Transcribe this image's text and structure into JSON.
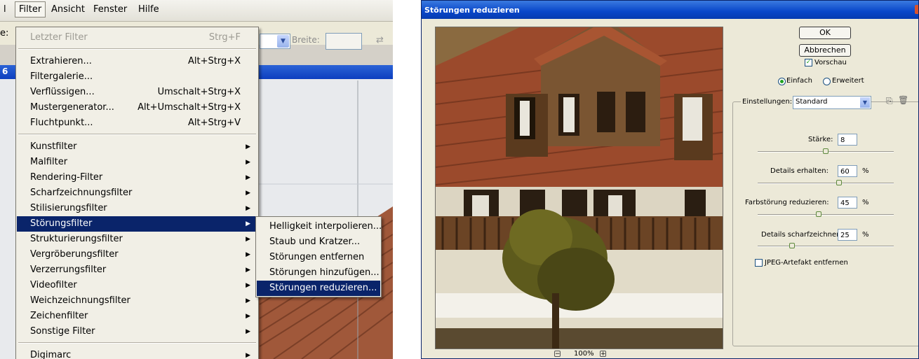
{
  "menubar": {
    "items": [
      "l",
      "Filter",
      "Ansicht",
      "Fenster",
      "Hilfe"
    ]
  },
  "optionsbar": {
    "cut_label": "e:",
    "width_label": "Breite:"
  },
  "filter_menu": {
    "items": [
      {
        "label": "Letzter Filter",
        "shortcut": "Strg+F"
      },
      {
        "label": "Extrahieren...",
        "shortcut": "Alt+Strg+X"
      },
      {
        "label": "Filtergalerie...",
        "shortcut": ""
      },
      {
        "label": "Verflüssigen...",
        "shortcut": "Umschalt+Strg+X"
      },
      {
        "label": "Mustergenerator...",
        "shortcut": "Alt+Umschalt+Strg+X"
      },
      {
        "label": "Fluchtpunkt...",
        "shortcut": "Alt+Strg+V"
      },
      {
        "label": "Kunstfilter"
      },
      {
        "label": "Malfilter"
      },
      {
        "label": "Rendering-Filter"
      },
      {
        "label": "Scharfzeichnungsfilter"
      },
      {
        "label": "Stilisierungsfilter"
      },
      {
        "label": "Störungsfilter"
      },
      {
        "label": "Strukturierungsfilter"
      },
      {
        "label": "Vergröberungsfilter"
      },
      {
        "label": "Verzerrungsfilter"
      },
      {
        "label": "Videofilter"
      },
      {
        "label": "Weichzeichnungsfilter"
      },
      {
        "label": "Zeichenfilter"
      },
      {
        "label": "Sonstige Filter"
      },
      {
        "label": "Digimarc"
      }
    ]
  },
  "noise_submenu": {
    "items": [
      "Helligkeit interpolieren...",
      "Staub und Kratzer...",
      "Störungen entfernen",
      "Störungen hinzufügen...",
      "Störungen reduzieren..."
    ]
  },
  "dialog": {
    "title": "Störungen reduzieren",
    "ok": "OK",
    "cancel": "Abbrechen",
    "preview_label": "Vorschau",
    "mode_simple": "Einfach",
    "mode_advanced": "Erweitert",
    "settings_label": "Einstellungen:",
    "settings_value": "Standard",
    "zoom": "100%",
    "strength_label": "Stärke:",
    "strength_value": "8",
    "details_label": "Details erhalten:",
    "details_value": "60",
    "color_label": "Farbstörung reduzieren:",
    "color_value": "45",
    "sharpen_label": "Details scharfzeichnen:",
    "sharpen_value": "25",
    "percent": "%",
    "jpeg_label": "JPEG-Artefakt entfernen",
    "sliders": {
      "strength": 0.5,
      "details": 0.6,
      "color": 0.45,
      "sharpen": 0.25
    }
  }
}
